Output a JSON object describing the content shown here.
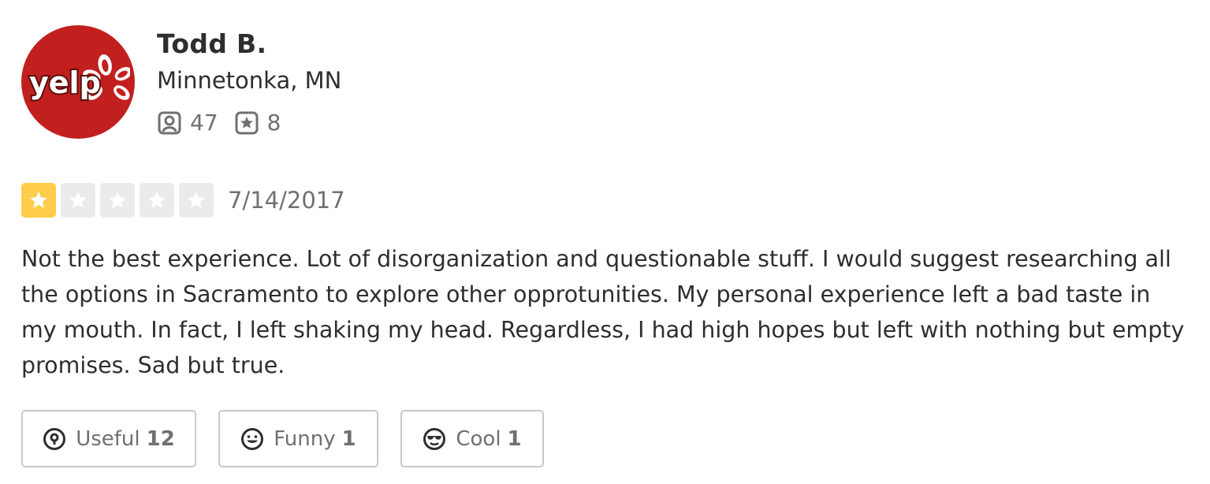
{
  "brand": {
    "logo_text": "yelp",
    "color": "#c1201f"
  },
  "user": {
    "name": "Todd B.",
    "location": "Minnetonka, MN",
    "friends_count": "47",
    "friends_icon": "friends-icon",
    "reviews_count": "8",
    "reviews_icon": "review-star-icon"
  },
  "review": {
    "rating": 1,
    "max_rating": 5,
    "star_filled_color": "#ffcc4b",
    "star_empty_color": "#ebebeb",
    "date": "7/14/2017",
    "text": "Not the best experience. Lot of disorganization and questionable stuff. I would suggest researching all the options in Sacramento to explore other opprotunities. My personal experience left a bad taste in my mouth. In fact, I left shaking my head. Regardless, I had high hopes but left with nothing but empty promises. Sad but true."
  },
  "reactions": {
    "useful": {
      "label": "Useful",
      "count": "12",
      "icon": "useful-icon"
    },
    "funny": {
      "label": "Funny",
      "count": "1",
      "icon": "funny-icon"
    },
    "cool": {
      "label": "Cool",
      "count": "1",
      "icon": "cool-icon"
    }
  }
}
